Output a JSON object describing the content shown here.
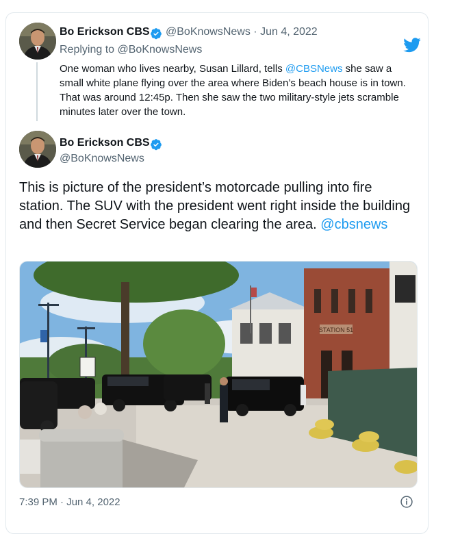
{
  "reply_tweet": {
    "author_name": "Bo Erickson CBS",
    "author_handle": "@BoKnowsNews",
    "date_separator": "·",
    "date": "Jun 4, 2022",
    "replying_to_label": "Replying to",
    "replying_to_handle": "@BoKnowsNews",
    "text_line1_before": "One woman who lives nearby, Susan Lillard, tells",
    "text_mention": "@CBSNews",
    "text_line1_after": "she saw",
    "text_rest": "a small white plane flying over the area where Biden’s beach house is in town. That was around 12:45p. Then she saw the two military-style jets scramble minutes later over the town."
  },
  "main_tweet": {
    "author_name": "Bo Erickson CBS",
    "author_handle": "@BoKnowsNews",
    "text": "This is picture of the president’s motorcade pulling into fire station. The SUV with the president went right inside the building and then Secret Service began clearing the area.",
    "mention": "@cbsnews",
    "timestamp": "7:39 PM · Jun 4, 2022",
    "photo_sign_text": "STATION 51"
  },
  "icons": {
    "brand": "twitter-bird-icon",
    "verified": "verified-badge-icon",
    "info": "info-icon"
  },
  "colors": {
    "link": "#1d9bf0",
    "verified": "#1d9bf0",
    "secondary_text": "#536471"
  }
}
